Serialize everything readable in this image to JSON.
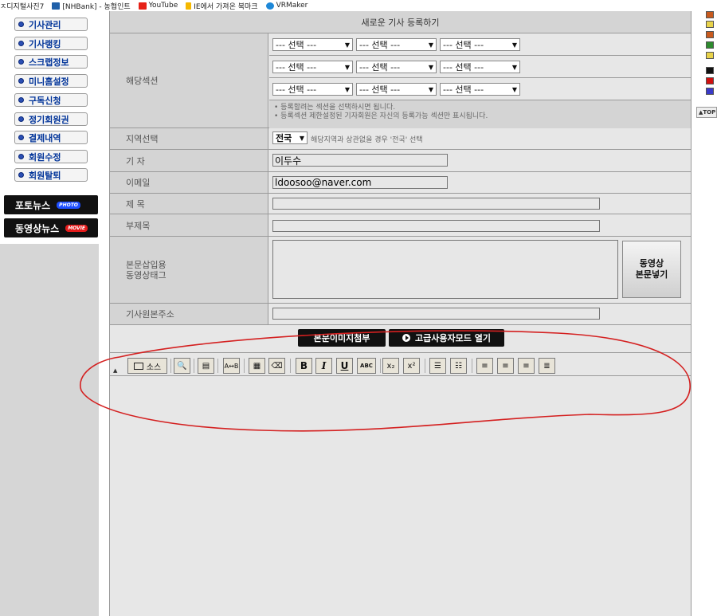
{
  "bookmarks": [
    {
      "label": "ㅈ디지털사진7",
      "icon_color": "#ffffff"
    },
    {
      "label": "[NHBank] - 농협인트",
      "icon_color": "#1f5fa8"
    },
    {
      "label": "YouTube",
      "icon_color": "#e62117"
    },
    {
      "label": "IE에서 가져온 북마크",
      "icon_color": "#f5b800"
    },
    {
      "label": "VRMaker",
      "icon_color": "#1e88d8"
    }
  ],
  "sidebar": {
    "menu": [
      "기사관리",
      "기사랭킹",
      "스크랩정보",
      "미니홈설정",
      "구독신청",
      "정기회원권",
      "결제내역",
      "회원수정",
      "회원탈퇴"
    ],
    "photo_news": {
      "label": "포토뉴스",
      "tag": "PHOTO",
      "tag_color": "#1e4fff"
    },
    "movie_news": {
      "label": "동영상뉴스",
      "tag": "MOVIE",
      "tag_color": "#e41b1b"
    }
  },
  "form": {
    "title": "새로운 기사 등록하기",
    "section_label": "해당섹션",
    "select_placeholder": "--- 선택 ---",
    "section_notes": [
      "• 등록할려는 섹션을 선택하시면 됩니다.",
      "• 등록섹션 제한설정된 기자회원은 자신의 등록가능 섹션만 표시됩니다."
    ],
    "region_label": "지역선택",
    "region_value": "전국",
    "region_hint": "해당지역과 상관없을 경우 '전국' 선택",
    "reporter_label": "기 자",
    "reporter_value": "이두수",
    "email_label": "이메일",
    "email_value": "ldoosoo@naver.com",
    "subject_label": "제 목",
    "subtitle_label": "부제목",
    "video_tag_label_1": "본문삽입용",
    "video_tag_label_2": "동영상태그",
    "video_btn_1": "동영상",
    "video_btn_2": "본문넣기",
    "source_url_label": "기사원본주소",
    "attach_image_btn": "본문이미지첨부",
    "advanced_mode_btn": "고급사용자모드 열기"
  },
  "toolbar": {
    "source_btn": "소스",
    "bold": "B",
    "italic": "I",
    "underline": "U",
    "strike": "ABC",
    "subscript": "x₂",
    "superscript": "x²"
  },
  "right_col": {
    "top_label": "▲TOP",
    "swatch_colors": [
      "#c85a1e",
      "#e8d24a",
      "#c85a1e",
      "#2e8b2e",
      "#e8d24a",
      "#111111",
      "#d01010",
      "#3a3ac8"
    ]
  },
  "colors": {
    "annotation": "#d42020",
    "menu_text": "#003399"
  }
}
